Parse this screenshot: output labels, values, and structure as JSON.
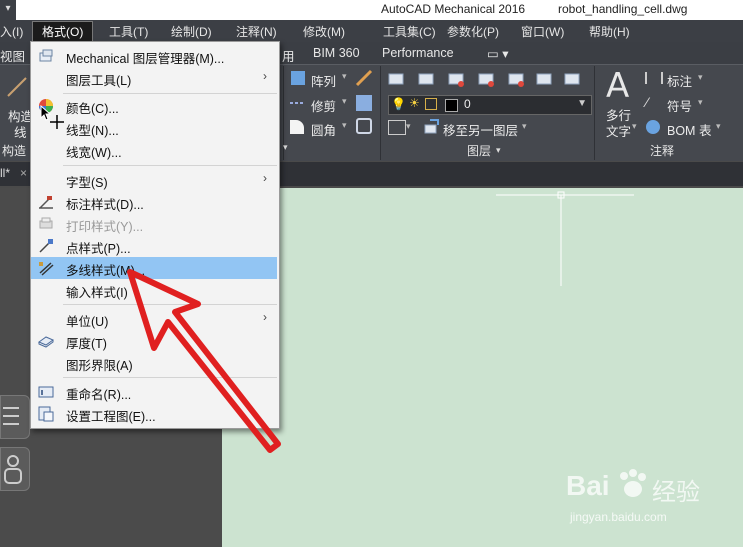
{
  "title_bar": {
    "app_title": "AutoCAD Mechanical 2016",
    "file_name": "robot_handling_cell.dwg",
    "quick_access": "▾"
  },
  "menubar": {
    "items": [
      "入(I)",
      "格式(O)",
      "工具(T)",
      "绘制(D)",
      "注释(N)",
      "修改(M)",
      "工具集(C)",
      "参数化(P)",
      "窗口(W)",
      "帮助(H)"
    ]
  },
  "ribbon_tabs": [
    "视图",
    "用",
    "BIM 360",
    "Performance",
    "▭ ▾"
  ],
  "ribbon": {
    "left_tool": {
      "label_line1": "构造",
      "label_line2": "线",
      "panel": "构造"
    },
    "modify": {
      "array": "阵列",
      "mirror": "修剪",
      "fillet": "圆角"
    },
    "layers": {
      "current_layer": "0",
      "move_to_layer": "移至另一图层",
      "panel": "图层"
    },
    "annotation": {
      "text_line1": "多行",
      "text_line2": "文字",
      "dimension": "标注",
      "symbol": "符号",
      "bom": "BOM 表",
      "panel": "注释"
    }
  },
  "doc_tab": {
    "label": "ll*",
    "close": "×"
  },
  "format_menu": {
    "items": [
      {
        "label": "Mechanical 图层管理器(M)...",
        "icon": "layer-manager-icon",
        "submenu": false,
        "disabled": false
      },
      {
        "label": "图层工具(L)",
        "icon": "",
        "submenu": true,
        "disabled": false
      },
      {
        "separator": true
      },
      {
        "label": "颜色(C)...",
        "icon": "color-wheel-icon",
        "submenu": false,
        "disabled": false
      },
      {
        "label": "线型(N)...",
        "icon": "",
        "submenu": false,
        "disabled": false
      },
      {
        "label": "线宽(W)...",
        "icon": "",
        "submenu": false,
        "disabled": false
      },
      {
        "separator": true
      },
      {
        "label": "字型(S)",
        "icon": "",
        "submenu": true,
        "disabled": false
      },
      {
        "label": "标注样式(D)...",
        "icon": "dim-style-icon",
        "submenu": false,
        "disabled": false
      },
      {
        "label": "打印样式(Y)...",
        "icon": "plot-style-icon",
        "submenu": false,
        "disabled": true
      },
      {
        "label": "点样式(P)...",
        "icon": "point-style-icon",
        "submenu": false,
        "disabled": false
      },
      {
        "label": "多线样式(M)...",
        "icon": "multiline-style-icon",
        "submenu": false,
        "disabled": false,
        "highlighted": true
      },
      {
        "label": "输入样式(I)",
        "icon": "",
        "submenu": false,
        "disabled": false
      },
      {
        "separator": true
      },
      {
        "label": "单位(U)",
        "icon": "",
        "submenu": true,
        "disabled": false
      },
      {
        "label": "厚度(T)",
        "icon": "thickness-icon",
        "submenu": false,
        "disabled": false
      },
      {
        "label": "图形界限(A)",
        "icon": "",
        "submenu": false,
        "disabled": false
      },
      {
        "separator": true
      },
      {
        "label": "重命名(R)...",
        "icon": "rename-icon",
        "submenu": false,
        "disabled": false
      },
      {
        "label": "设置工程图(E)...",
        "icon": "drawing-setup-icon",
        "submenu": false,
        "disabled": false
      }
    ]
  },
  "watermark": {
    "brand": "Bai",
    "brand2": "经验",
    "url": "jingyan.baidu.com"
  },
  "colors": {
    "highlight": "#92c5f3",
    "drawing_bg": "#cce3d0",
    "annotation_arrow": "#e02020"
  }
}
